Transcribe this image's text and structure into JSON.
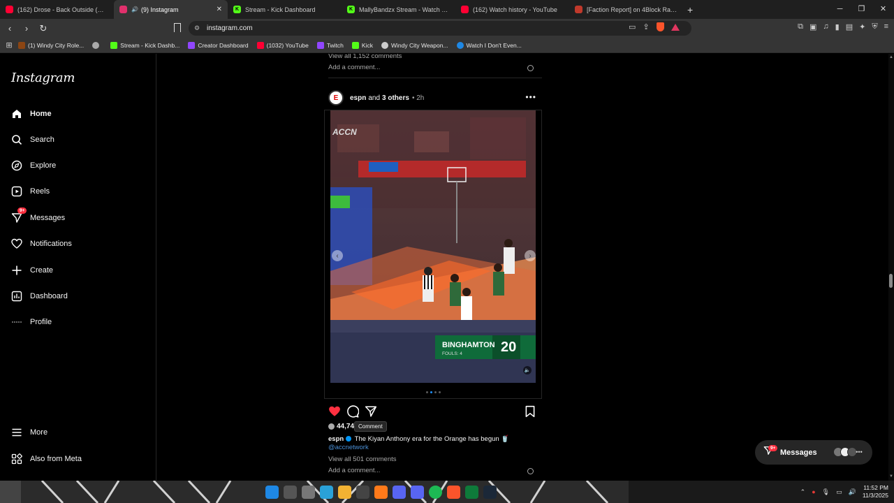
{
  "browser": {
    "tabs": [
      {
        "label": "(162) Drose - Back Outside (Official M",
        "favicon_color": "#ff0033",
        "active": false
      },
      {
        "label": "(9) Instagram",
        "favicon_color": "#e1306c",
        "active": true
      },
      {
        "label": "Stream - Kick Dashboard",
        "favicon_color": "#53fc18",
        "active": false
      },
      {
        "label": "MallyBandzx Stream - Watch Live on",
        "favicon_color": "#53fc18",
        "active": false
      },
      {
        "label": "(162) Watch history - YouTube",
        "favicon_color": "#ff0033",
        "active": false
      },
      {
        "label": "[Faction Report] on 4Block Rack City",
        "favicon_color": "#c0392b",
        "active": false
      }
    ],
    "url": "instagram.com",
    "bookmarks": [
      {
        "label": "(1) Windy City Role...",
        "color": "#8b4513"
      },
      {
        "label": "",
        "color": "#aaaaaa"
      },
      {
        "label": "Stream - Kick Dashb...",
        "color": "#53fc18"
      },
      {
        "label": "Creator Dashboard",
        "color": "#9146ff"
      },
      {
        "label": "(1032) YouTube",
        "color": "#ff0033"
      },
      {
        "label": "Twitch",
        "color": "#9146ff"
      },
      {
        "label": "Kick",
        "color": "#53fc18"
      },
      {
        "label": "Windy City Weapon...",
        "color": "#cccccc"
      },
      {
        "label": "Watch I Don't Even...",
        "color": "#1e88e5"
      }
    ]
  },
  "sidebar": {
    "logo": "Instagram",
    "items": [
      {
        "label": "Home",
        "icon": "home-icon"
      },
      {
        "label": "Search",
        "icon": "search-icon"
      },
      {
        "label": "Explore",
        "icon": "compass-icon"
      },
      {
        "label": "Reels",
        "icon": "reels-icon"
      },
      {
        "label": "Messages",
        "icon": "messenger-icon",
        "badge": "9+"
      },
      {
        "label": "Notifications",
        "icon": "heart-icon"
      },
      {
        "label": "Create",
        "icon": "plus-icon"
      },
      {
        "label": "Dashboard",
        "icon": "chart-icon"
      },
      {
        "label": "Profile",
        "icon": "avatar-icon"
      }
    ],
    "bottom": [
      {
        "label": "More",
        "icon": "menu-icon"
      },
      {
        "label": "Also from Meta",
        "icon": "meta-icon"
      }
    ]
  },
  "feed": {
    "prev_post": {
      "view_all": "View all 1,152 comments",
      "add_comment": "Add a comment..."
    },
    "post": {
      "author": "espn",
      "with_text": "and",
      "others": "3 others",
      "time": "2h",
      "scoreboard_team": "BINGHAMTON",
      "scoreboard_score": "20",
      "scoreboard_fouls": "FOULS: 4",
      "network_logo": "ACCN",
      "carousel_index": 2,
      "carousel_total": 4,
      "likes": "44,74",
      "tooltip": "Comment",
      "caption_user": "espn",
      "caption_text": "The Kiyan Anthony era for the Orange has begun 🥤",
      "caption_mention": "@accnetwork",
      "view_all": "View all 501 comments",
      "add_comment": "Add a comment..."
    }
  },
  "messages_pill": {
    "label": "Messages",
    "badge": "9+"
  },
  "taskbar": {
    "time": "11:52 PM",
    "date": "11/3/2025"
  },
  "colors": {
    "like_red": "#ff3040",
    "link_blue": "#0095f6"
  }
}
